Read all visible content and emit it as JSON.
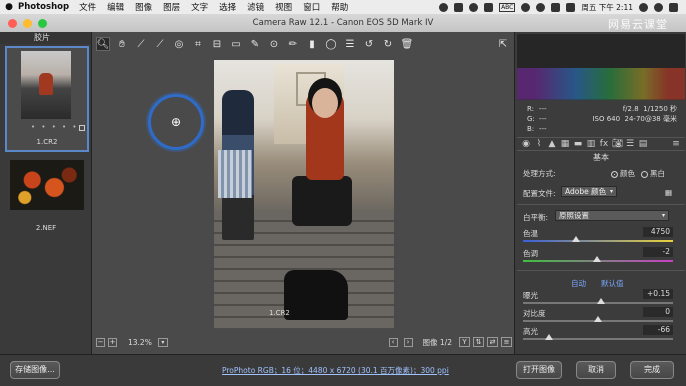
{
  "menubar": {
    "app": "Photoshop",
    "items": [
      "文件",
      "编辑",
      "图像",
      "图层",
      "文字",
      "选择",
      "滤镜",
      "视图",
      "窗口",
      "帮助"
    ],
    "abc": "ABC",
    "clock": "周五 下午 2:11"
  },
  "window": {
    "title": "Camera Raw 12.1  -  Canon EOS 5D Mark IV",
    "watermark": "网易云课堂"
  },
  "filmstrip": {
    "header": "胶片",
    "items": [
      {
        "name": "1.CR2",
        "selected": true,
        "rating_dots": "• • • • •"
      },
      {
        "name": "2.NEF",
        "selected": false
      }
    ]
  },
  "toolbar": {
    "tools": [
      "zoom-tool",
      "hand-tool",
      "white-balance-tool",
      "color-sampler-tool",
      "targeted-adjustment-tool",
      "crop-tool",
      "straighten-tool",
      "transform-tool",
      "spot-removal-tool",
      "red-eye-tool",
      "adjustment-brush",
      "graduated-filter",
      "radial-filter",
      "preferences",
      "rotate-left",
      "rotate-right",
      "trash"
    ]
  },
  "canvas": {
    "filename": "1.CR2",
    "zoom": "13.2%",
    "image_counter": "图像 1/2"
  },
  "histogram": {
    "r": "---",
    "g": "---",
    "b": "---",
    "aperture": "f/2.8",
    "shutter": "1/1250 秒",
    "iso": "ISO 640",
    "lens": "24-70@38 毫米"
  },
  "basic_panel": {
    "title": "基本",
    "treatment_label": "处理方式:",
    "treatment_color": "颜色",
    "treatment_bw": "黑白",
    "profile_label": "配置文件:",
    "profile_value": "Adobe 颜色",
    "wb_label": "白平衡:",
    "wb_value": "原照设置",
    "temperature": {
      "label": "色温",
      "value": "4750",
      "position": 0.35
    },
    "tint": {
      "label": "色调",
      "value": "-2",
      "position": 0.49
    },
    "auto_label": "自动",
    "default_label": "默认值",
    "exposure": {
      "label": "曝光",
      "value": "+0.15",
      "position": 0.52
    },
    "contrast": {
      "label": "对比度",
      "value": "0",
      "position": 0.5
    },
    "highlights": {
      "label": "高光",
      "value": "-66",
      "position": 0.17
    }
  },
  "footer": {
    "save_button": "存储图像...",
    "workflow_info": "ProPhoto RGB；16 位；4480 x 6720 (30.1 百万像素)；300 ppi",
    "open_button": "打开图像",
    "cancel_button": "取消",
    "done_button": "完成"
  }
}
